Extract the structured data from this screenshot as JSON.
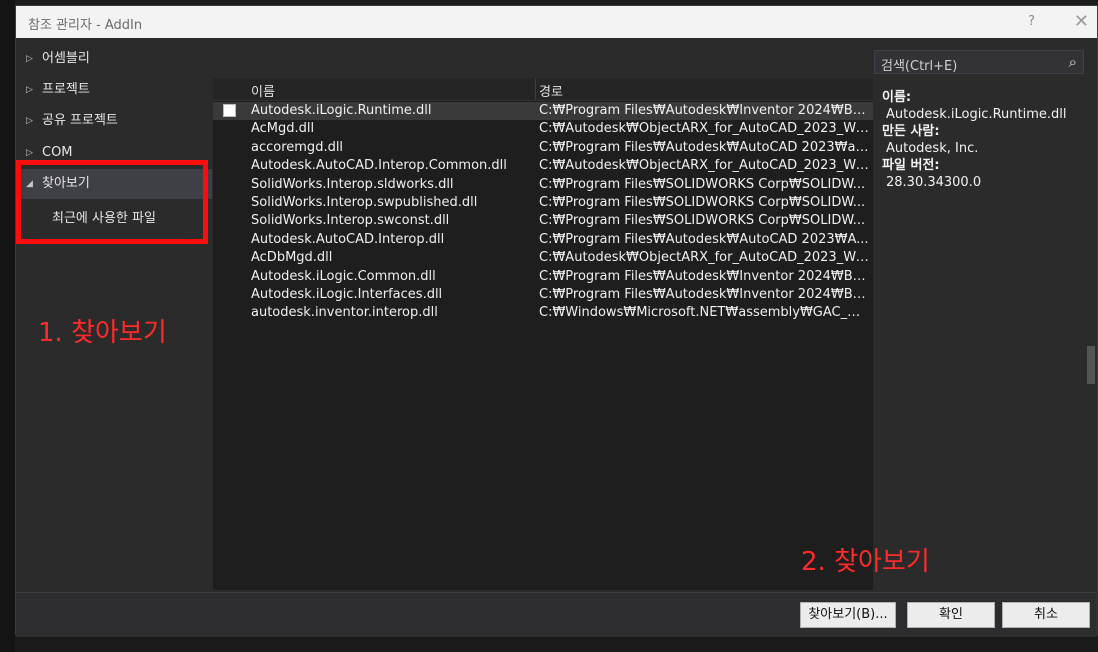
{
  "window": {
    "title": "참조 관리자 - AddIn",
    "help_label": "?",
    "close_label": "✕"
  },
  "nav": {
    "items": [
      {
        "label": "어셈블리",
        "arrow": "▷"
      },
      {
        "label": "프로젝트",
        "arrow": "▷"
      },
      {
        "label": "공유 프로젝트",
        "arrow": "▷"
      },
      {
        "label": "COM",
        "arrow": "▷"
      },
      {
        "label": "찾아보기",
        "arrow": "◢"
      }
    ],
    "sub_item": "최근에 사용한 파일"
  },
  "annotations": {
    "step1": "1. 찾아보기",
    "step2": "2. 찾아보기"
  },
  "table": {
    "col_name": "이름",
    "col_path": "경로",
    "rows": [
      {
        "name": "Autodesk.iLogic.Runtime.dll",
        "path": "C:₩Program Files₩Autodesk₩Inventor 2024₩Bin..."
      },
      {
        "name": "AcMgd.dll",
        "path": "C:₩Autodesk₩ObjectARX_for_AutoCAD_2023_Wi..."
      },
      {
        "name": "accoremgd.dll",
        "path": "C:₩Program Files₩Autodesk₩AutoCAD 2023₩ac..."
      },
      {
        "name": "Autodesk.AutoCAD.Interop.Common.dll",
        "path": "C:₩Autodesk₩ObjectARX_for_AutoCAD_2023_Wi..."
      },
      {
        "name": "SolidWorks.Interop.sldworks.dll",
        "path": "C:₩Program Files₩SOLIDWORKS Corp₩SOLIDW..."
      },
      {
        "name": "SolidWorks.Interop.swpublished.dll",
        "path": "C:₩Program Files₩SOLIDWORKS Corp₩SOLIDW..."
      },
      {
        "name": "SolidWorks.Interop.swconst.dll",
        "path": "C:₩Program Files₩SOLIDWORKS Corp₩SOLIDW..."
      },
      {
        "name": "Autodesk.AutoCAD.Interop.dll",
        "path": "C:₩Program Files₩Autodesk₩AutoCAD 2023₩A..."
      },
      {
        "name": "AcDbMgd.dll",
        "path": "C:₩Autodesk₩ObjectARX_for_AutoCAD_2023_Wi..."
      },
      {
        "name": "Autodesk.iLogic.Common.dll",
        "path": "C:₩Program Files₩Autodesk₩Inventor 2024₩Bin..."
      },
      {
        "name": "Autodesk.iLogic.Interfaces.dll",
        "path": "C:₩Program Files₩Autodesk₩Inventor 2024₩Bin..."
      },
      {
        "name": "autodesk.inventor.interop.dll",
        "path": "C:₩Windows₩Microsoft.NET₩assembly₩GAC_MS..."
      }
    ]
  },
  "search": {
    "placeholder": "검색(Ctrl+E)",
    "icon": "search-icon"
  },
  "details": {
    "name_label": "이름:",
    "name_value": "Autodesk.iLogic.Runtime.dll",
    "author_label": "만든 사람:",
    "author_value": "Autodesk, Inc.",
    "version_label": "파일 버전:",
    "version_value": "28.30.34300.0"
  },
  "buttons": {
    "browse": "찾아보기(B)...",
    "ok": "확인",
    "cancel": "취소"
  },
  "colors": {
    "highlight": "#ff0d0d",
    "annotation": "#ff2a2a"
  }
}
